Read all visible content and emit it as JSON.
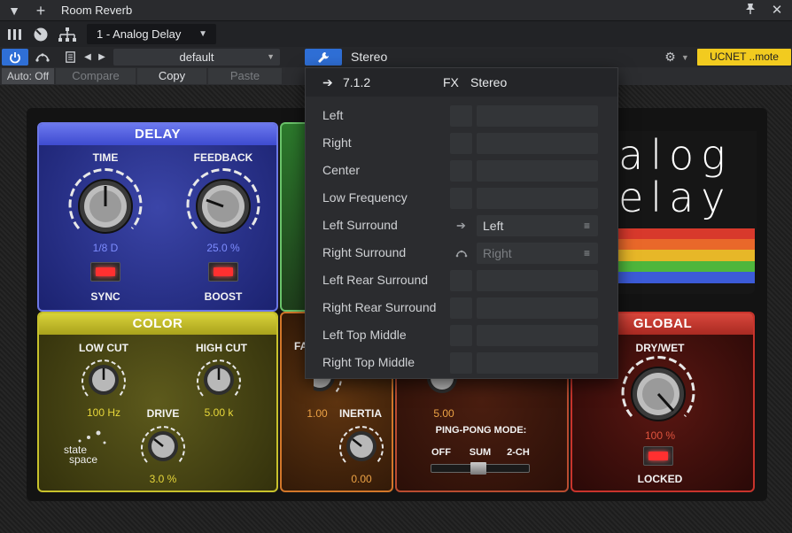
{
  "window": {
    "title": "Room Reverb"
  },
  "toolbar": {
    "preset_slot": "1 - Analog Delay"
  },
  "controls": {
    "preset_name": "default",
    "routing_label": "Stereo",
    "network_badge": "UCNET ..mote",
    "auto_label": "Auto: Off",
    "compare_label": "Compare",
    "copy_label": "Copy",
    "paste_label": "Paste"
  },
  "plugin": {
    "logo_text_line1": "alog",
    "logo_text_line2": "elay",
    "delay": {
      "title": "DELAY",
      "time_label": "TIME",
      "time_value": "1/8 D",
      "feedback_label": "FEEDBACK",
      "feedback_value": "25.0 %",
      "sync_label": "SYNC",
      "boost_label": "BOOST"
    },
    "color": {
      "title": "COLOR",
      "lowcut_label": "LOW CUT",
      "lowcut_value": "100 Hz",
      "highcut_label": "HIGH CUT",
      "highcut_value": "5.00 k",
      "drive_label": "DRIVE",
      "drive_value": "3.0 %",
      "brand_line1": "state",
      "brand_line2": "space"
    },
    "modulation": {
      "partial_label": "FA",
      "rate_value": "1.00",
      "inertia_label": "INERTIA",
      "inertia_value": "0.00"
    },
    "pingpong": {
      "value": "5.00",
      "mode_label": "PING-PONG MODE:",
      "off_label": "OFF",
      "sum_label": "SUM",
      "ch2_label": "2-CH"
    },
    "global": {
      "title": "GLOBAL",
      "drywet_label": "DRY/WET",
      "drywet_value": "100 %",
      "locked_label": "LOCKED"
    }
  },
  "routing_panel": {
    "header_format": "7.1.2",
    "header_fx": "FX",
    "header_stereo": "Stereo",
    "channels": [
      {
        "name": "Left",
        "mapping": ""
      },
      {
        "name": "Right",
        "mapping": ""
      },
      {
        "name": "Center",
        "mapping": ""
      },
      {
        "name": "Low Frequency",
        "mapping": ""
      },
      {
        "name": "Left Surround",
        "mapping": "Left"
      },
      {
        "name": "Right Surround",
        "mapping": "Right"
      },
      {
        "name": "Left Rear Surround",
        "mapping": ""
      },
      {
        "name": "Right Rear Surround",
        "mapping": ""
      },
      {
        "name": "Left Top Middle",
        "mapping": ""
      },
      {
        "name": "Right Top Middle",
        "mapping": ""
      }
    ]
  },
  "colors": {
    "accent_blue": "#2f6fd6",
    "badge_yellow": "#f2cb1f",
    "delay_blue": "#4a58d8",
    "color_yellow": "#c8c22c",
    "global_red": "#c8342c"
  }
}
